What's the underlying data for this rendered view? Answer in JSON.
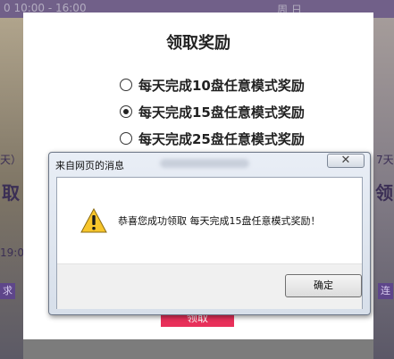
{
  "background": {
    "top_left_text": "0 10:00 - 16:00",
    "top_right_text": "周 日",
    "left_big_text": "取",
    "left_small_text": "天）",
    "left_time": "19:0",
    "left_pill": "求",
    "right_big_text": "领",
    "right_small_text": "7天",
    "right_pill": "连"
  },
  "modal": {
    "title": "领取奖励",
    "options": [
      {
        "label": "每天完成10盘任意模式奖励",
        "checked": false
      },
      {
        "label": "每天完成15盘任意模式奖励",
        "checked": true
      },
      {
        "label": "每天完成25盘任意模式奖励",
        "checked": false
      }
    ],
    "confirm_label": "领取"
  },
  "alert": {
    "caption": "来自网页的消息",
    "close_symbol": "✕",
    "message": "恭喜您成功领取 每天完成15盘任意模式奖励！",
    "ok_label": "确定",
    "icon": "warning-icon"
  },
  "colors": {
    "accent_red": "#e8305a",
    "purple": "#6a4f92",
    "warning_yellow": "#f7c52b"
  }
}
